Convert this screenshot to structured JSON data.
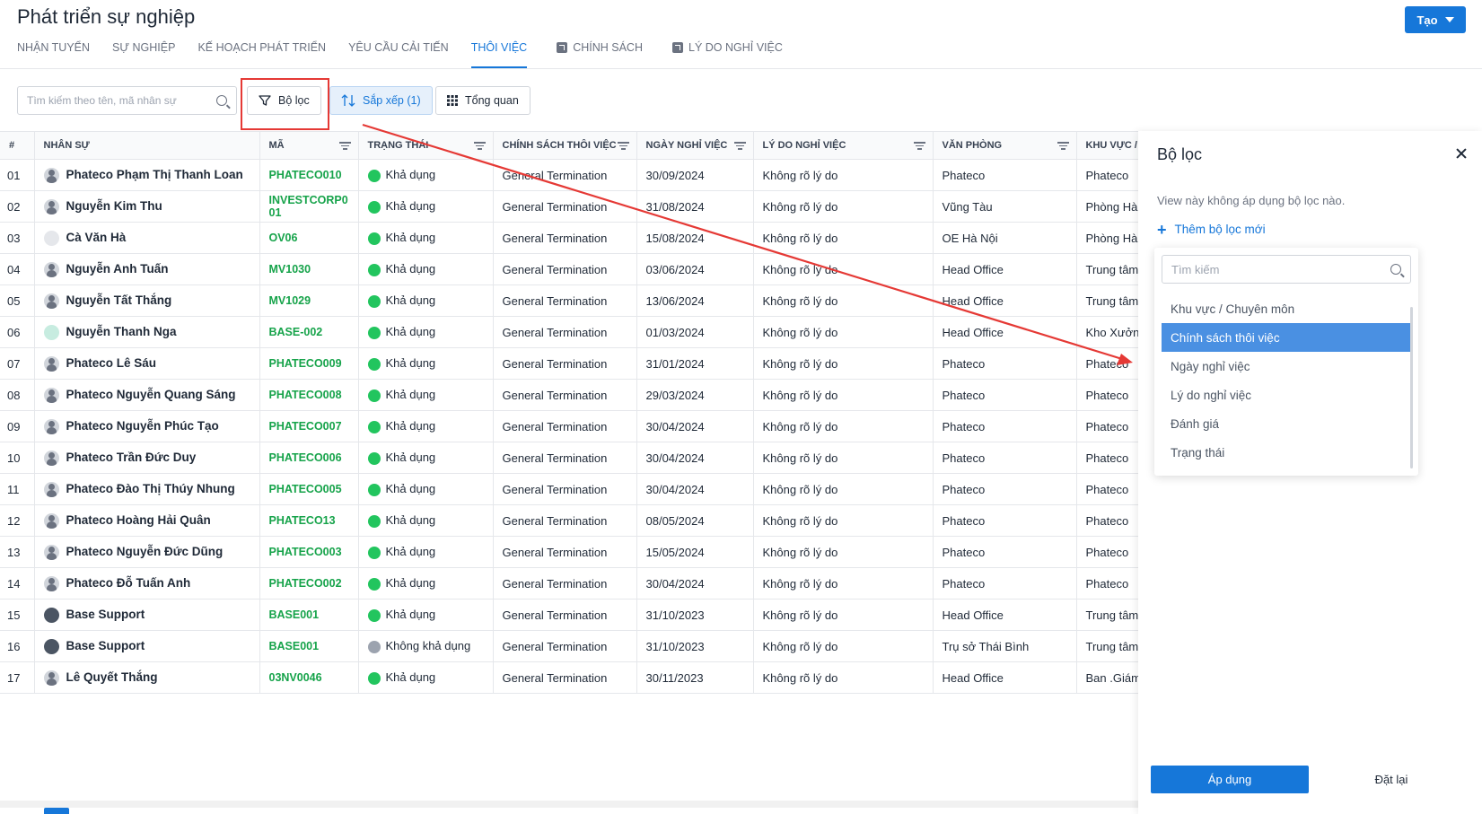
{
  "page": {
    "title": "Phát triển sự nghiệp"
  },
  "header": {
    "create_label": "Tạo"
  },
  "tabs": [
    {
      "label": "NHẬN TUYỂN"
    },
    {
      "label": "SỰ NGHIỆP"
    },
    {
      "label": "KẾ HOẠCH PHÁT TRIỂN"
    },
    {
      "label": "YÊU CẦU CẢI TIẾN"
    },
    {
      "label": "THÔI VIỆC",
      "active": true
    },
    {
      "label": "CHÍNH SÁCH",
      "external": true
    },
    {
      "label": "LÝ DO NGHỈ VIỆC",
      "external": true
    }
  ],
  "toolbar": {
    "search_placeholder": "Tìm kiếm theo tên, mã nhân sự",
    "filter_label": "Bộ lọc",
    "sort_label": "Sắp xếp (1)",
    "overview_label": "Tổng quan"
  },
  "table": {
    "columns": [
      "#",
      "NHÂN SỰ",
      "MÃ",
      "TRẠNG THÁI",
      "CHÍNH SÁCH THÔI VIỆC",
      "NGÀY NGHỈ VIỆC",
      "LÝ DO NGHỈ VIỆC",
      "VĂN PHÒNG",
      "KHU VỰC / C"
    ],
    "rows": [
      {
        "idx": "01",
        "name": "Phateco Phạm Thị Thanh Loan",
        "code": "PHATECO010",
        "status": "Khả dụng",
        "policy": "General Termination",
        "date": "30/09/2024",
        "reason": "Không rõ lý do",
        "office": "Phateco",
        "area": "Phateco",
        "avatar": "person"
      },
      {
        "idx": "02",
        "name": "Nguyễn Kim Thu",
        "code": "INVESTCORP0 01",
        "status": "Khả dụng",
        "policy": "General Termination",
        "date": "31/08/2024",
        "reason": "Không rõ lý do",
        "office": "Vũng Tàu",
        "area": "Phòng Hàn",
        "avatar": "person"
      },
      {
        "idx": "03",
        "name": "Cà Văn Hà",
        "code": "OV06",
        "status": "Khả dụng",
        "policy": "General Termination",
        "date": "15/08/2024",
        "reason": "Không rõ lý do",
        "office": "OE Hà Nội",
        "area": "Phòng Hàn",
        "avatar": "light"
      },
      {
        "idx": "04",
        "name": "Nguyễn Anh Tuấn",
        "code": "MV1030",
        "status": "Khả dụng",
        "policy": "General Termination",
        "date": "03/06/2024",
        "reason": "Không rõ lý do",
        "office": "Head Office",
        "area": "Trung tâm",
        "avatar": "person"
      },
      {
        "idx": "05",
        "name": "Nguyễn Tất Thắng",
        "code": "MV1029",
        "status": "Khả dụng",
        "policy": "General Termination",
        "date": "13/06/2024",
        "reason": "Không rõ lý do",
        "office": "Head Office",
        "area": "Trung tâm",
        "avatar": "person"
      },
      {
        "idx": "06",
        "name": "Nguyễn Thanh Nga",
        "code": "BASE-002",
        "status": "Khả dụng",
        "policy": "General Termination",
        "date": "01/03/2024",
        "reason": "Không rõ lý do",
        "office": "Head Office",
        "area": "Kho Xưởng",
        "avatar": "mint"
      },
      {
        "idx": "07",
        "name": "Phateco Lê Sáu",
        "code": "PHATECO009",
        "status": "Khả dụng",
        "policy": "General Termination",
        "date": "31/01/2024",
        "reason": "Không rõ lý do",
        "office": "Phateco",
        "area": "Phateco",
        "avatar": "person"
      },
      {
        "idx": "08",
        "name": "Phateco Nguyễn Quang Sáng",
        "code": "PHATECO008",
        "status": "Khả dụng",
        "policy": "General Termination",
        "date": "29/03/2024",
        "reason": "Không rõ lý do",
        "office": "Phateco",
        "area": "Phateco",
        "avatar": "person"
      },
      {
        "idx": "09",
        "name": "Phateco Nguyễn Phúc Tạo",
        "code": "PHATECO007",
        "status": "Khả dụng",
        "policy": "General Termination",
        "date": "30/04/2024",
        "reason": "Không rõ lý do",
        "office": "Phateco",
        "area": "Phateco",
        "avatar": "person"
      },
      {
        "idx": "10",
        "name": "Phateco Trần Đức Duy",
        "code": "PHATECO006",
        "status": "Khả dụng",
        "policy": "General Termination",
        "date": "30/04/2024",
        "reason": "Không rõ lý do",
        "office": "Phateco",
        "area": "Phateco",
        "avatar": "person"
      },
      {
        "idx": "11",
        "name": "Phateco Đào Thị Thúy Nhung",
        "code": "PHATECO005",
        "status": "Khả dụng",
        "policy": "General Termination",
        "date": "30/04/2024",
        "reason": "Không rõ lý do",
        "office": "Phateco",
        "area": "Phateco",
        "avatar": "person"
      },
      {
        "idx": "12",
        "name": "Phateco Hoàng Hải Quân",
        "code": "PHATECO13",
        "status": "Khả dụng",
        "policy": "General Termination",
        "date": "08/05/2024",
        "reason": "Không rõ lý do",
        "office": "Phateco",
        "area": "Phateco",
        "avatar": "person"
      },
      {
        "idx": "13",
        "name": "Phateco Nguyễn Đức Dũng",
        "code": "PHATECO003",
        "status": "Khả dụng",
        "policy": "General Termination",
        "date": "15/05/2024",
        "reason": "Không rõ lý do",
        "office": "Phateco",
        "area": "Phateco",
        "avatar": "person"
      },
      {
        "idx": "14",
        "name": "Phateco Đỗ Tuấn Anh",
        "code": "PHATECO002",
        "status": "Khả dụng",
        "policy": "General Termination",
        "date": "30/04/2024",
        "reason": "Không rõ lý do",
        "office": "Phateco",
        "area": "Phateco",
        "avatar": "person"
      },
      {
        "idx": "15",
        "name": "Base Support",
        "code": "BASE001",
        "status": "Khả dụng",
        "policy": "General Termination",
        "date": "31/10/2023",
        "reason": "Không rõ lý do",
        "office": "Head Office",
        "area": "Trung tâm",
        "avatar": "photo"
      },
      {
        "idx": "16",
        "name": "Base Support",
        "code": "BASE001",
        "status": "Không khả dụng",
        "policy": "General Termination",
        "date": "31/10/2023",
        "reason": "Không rõ lý do",
        "office": "Trụ sở Thái Bình",
        "area": "Trung tâm",
        "avatar": "photo"
      },
      {
        "idx": "17",
        "name": "Lê Quyết Thắng",
        "code": "03NV0046",
        "status": "Khả dụng",
        "policy": "General Termination",
        "date": "30/11/2023",
        "reason": "Không rõ lý do",
        "office": "Head Office",
        "area": "Ban .Giám",
        "avatar": "person"
      }
    ]
  },
  "colors": {
    "accent": "#1677d9",
    "status_available": "#22c55e",
    "status_unavailable": "#9ca3af",
    "code_text": "#16a34a",
    "annotation_red": "#e53935"
  },
  "filter_panel": {
    "title": "Bộ lọc",
    "note": "View này không áp dụng bộ lọc nào.",
    "add_label": "Thêm bộ lọc mới",
    "search_placeholder": "Tìm kiếm",
    "options": [
      {
        "label": "Khu vực / Chuyên môn"
      },
      {
        "label": "Chính sách thôi việc",
        "selected": true
      },
      {
        "label": "Ngày nghỉ việc"
      },
      {
        "label": "Lý do nghỉ việc"
      },
      {
        "label": "Đánh giá"
      },
      {
        "label": "Trạng thái"
      }
    ],
    "apply_label": "Áp dụng",
    "reset_label": "Đặt lại"
  }
}
